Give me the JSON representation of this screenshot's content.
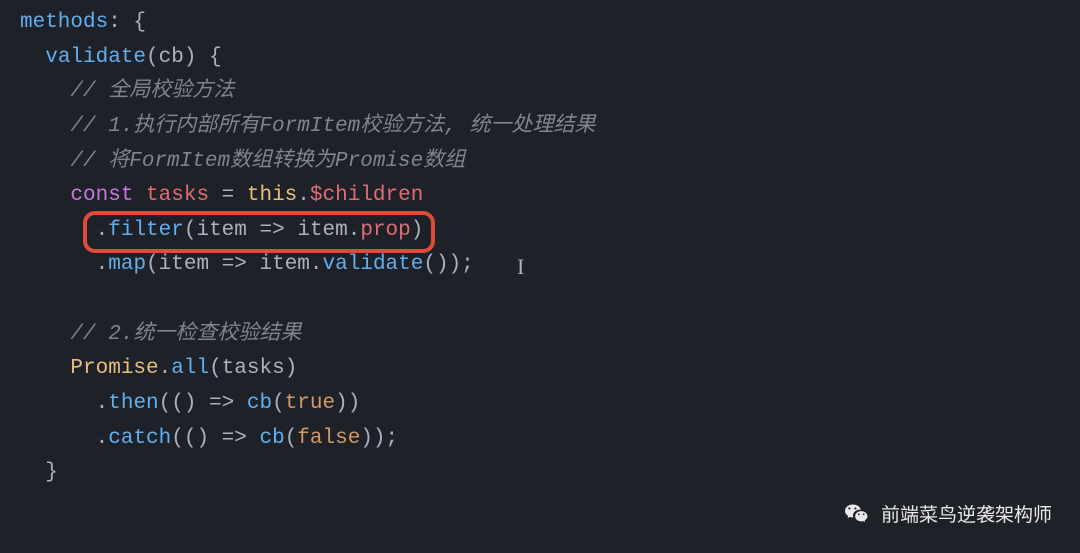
{
  "code": {
    "line1": {
      "methods": "methods",
      "colon_brace": ": {"
    },
    "line2": {
      "func": "validate",
      "open": "(",
      "param": "cb",
      "close_brace": ") {"
    },
    "line3": {
      "comment": "// 全局校验方法"
    },
    "line4": {
      "comment": "// 1.执行内部所有FormItem校验方法, 统一处理结果"
    },
    "line5": {
      "comment": "// 将FormItem数组转换为Promise数组"
    },
    "line6": {
      "const": "const",
      "varname": "tasks",
      "eq": " = ",
      "this": "this",
      "dot": ".",
      "prop": "$children"
    },
    "line7": {
      "dot": ".",
      "filter": "filter",
      "open": "(",
      "item1": "item",
      "arrow": " => ",
      "item2": "item",
      "dot2": ".",
      "prop": "prop",
      "close": ")"
    },
    "line8": {
      "dot": ".",
      "map": "map",
      "open": "(",
      "item1": "item",
      "arrow": " => ",
      "item2": "item",
      "dot2": ".",
      "validate": "validate",
      "parens": "()",
      "close": ");"
    },
    "line10": {
      "comment": "// 2.统一检查校验结果"
    },
    "line11": {
      "promise": "Promise",
      "dot": ".",
      "all": "all",
      "open": "(",
      "tasks": "tasks",
      "close": ")"
    },
    "line12": {
      "dot": ".",
      "then": "then",
      "open": "(() => ",
      "cb": "cb",
      "open2": "(",
      "true": "true",
      "close": "))"
    },
    "line13": {
      "dot": ".",
      "catch": "catch",
      "open": "(() => ",
      "cb": "cb",
      "open2": "(",
      "false": "false",
      "close": "));"
    },
    "line14": {
      "brace": "}"
    }
  },
  "watermark": "前端菜鸟逆袭架构师",
  "cursor_glyph": "I"
}
